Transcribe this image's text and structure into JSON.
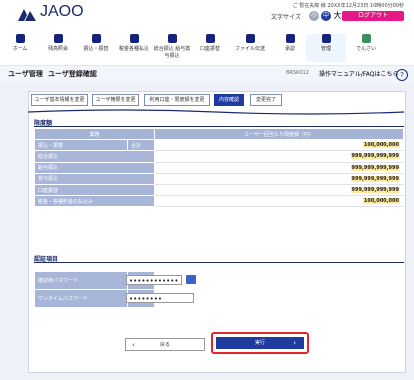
{
  "brand": {
    "name": "JAOO"
  },
  "header": {
    "user_info": "ご 暫在夫郎 様 20XX年12月23日 10時00分00秒",
    "font_size_label": "文字サイズ",
    "font_small": "小",
    "font_medium": "中",
    "font_large": "大",
    "logout_label": "ログアウト"
  },
  "nav": {
    "items": [
      {
        "label": "ホーム"
      },
      {
        "label": "残高照会"
      },
      {
        "label": "振込・振替"
      },
      {
        "label": "税金各種払込"
      },
      {
        "label": "総合振込 給与賞与振込"
      },
      {
        "label": "口座振替"
      },
      {
        "label": "ファイル伝送"
      },
      {
        "label": "承認"
      },
      {
        "label": "管理"
      },
      {
        "label": "でんさい"
      }
    ]
  },
  "title_bar": {
    "section": "ユーザ管理",
    "page_title": "ユーザ登録確認",
    "screen_code": "BRSK012",
    "manual_link": "操作マニュアル/FAQはこちら"
  },
  "steps": [
    {
      "label": "ユーザ基本情報を変更"
    },
    {
      "label": "ユーザ権限を変更"
    },
    {
      "label": "利用口座・限度額を変更"
    },
    {
      "label": "内容確認"
    },
    {
      "label": "変更完了"
    }
  ],
  "limits": {
    "section_title": "限度額",
    "col_type": "業務",
    "col_limit": "ユーザ一回当たり限度額（円）",
    "rows": [
      {
        "label": "振込・振替",
        "sub": "合計",
        "value": "100,000,000",
        "highlight": true
      },
      {
        "label": "総合振込",
        "value": "999,999,999,999",
        "highlight": true
      },
      {
        "label": "給与振込",
        "value": "999,999,999,999",
        "highlight": true
      },
      {
        "label": "賞与振込",
        "value": "999,999,999,999",
        "highlight": true
      },
      {
        "label": "口座振替",
        "value": "999,999,999,999",
        "highlight": true
      },
      {
        "label": "税金・各種料金の払込み",
        "value": "100,000,000",
        "highlight": true
      }
    ]
  },
  "auth": {
    "section_title": "認証項目",
    "rows": [
      {
        "label": "確認用パスワード",
        "required": "必須",
        "value": "••••••••••••"
      },
      {
        "label": "ワンタイムパスワード",
        "required": "必須",
        "value": "••••••••"
      }
    ]
  },
  "buttons": {
    "back": "戻る",
    "execute": "実行"
  },
  "colors": {
    "brand_navy": "#1d2a6d",
    "accent_pink": "#e61787",
    "button_blue": "#1f3b9f",
    "highlight_yellow": "#ffe99a",
    "required_red": "#c2202d"
  }
}
